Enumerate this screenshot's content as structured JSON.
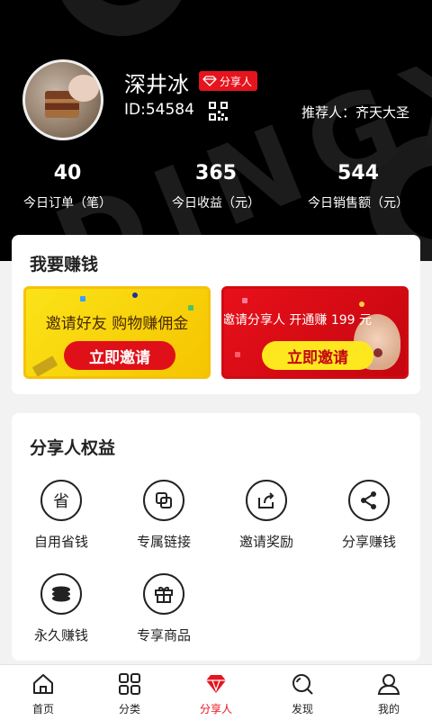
{
  "profile": {
    "name": "深井冰",
    "badge": "分享人",
    "id_text": "ID:54584",
    "referrer": "推荐人：齐天大圣"
  },
  "watermark": "DINGXIAO",
  "stats": [
    {
      "value": "40",
      "label": "今日订单（笔）"
    },
    {
      "value": "365",
      "label": "今日收益（元）"
    },
    {
      "value": "544",
      "label": "今日销售额（元）"
    }
  ],
  "earn": {
    "title": "我要赚钱",
    "banners": [
      {
        "text": "邀请好友  购物赚佣金",
        "button": "立即邀请"
      },
      {
        "text": "邀请分享人 开通赚 199 元",
        "button": "立即邀请"
      }
    ]
  },
  "benefits": {
    "title": "分享人权益",
    "items": [
      {
        "label": "自用省钱",
        "icon": "save-money-icon",
        "glyph": "省"
      },
      {
        "label": "专属链接",
        "icon": "link-icon"
      },
      {
        "label": "邀请奖励",
        "icon": "invite-reward-icon"
      },
      {
        "label": "分享赚钱",
        "icon": "share-icon"
      },
      {
        "label": "永久赚钱",
        "icon": "coins-icon"
      },
      {
        "label": "专享商品",
        "icon": "gift-icon"
      }
    ]
  },
  "tabs": [
    {
      "label": "首页",
      "icon": "home-icon"
    },
    {
      "label": "分类",
      "icon": "category-icon"
    },
    {
      "label": "分享人",
      "icon": "diamond-icon",
      "active": true
    },
    {
      "label": "发现",
      "icon": "discover-icon"
    },
    {
      "label": "我的",
      "icon": "profile-icon"
    }
  ],
  "colors": {
    "accent": "#e5141e",
    "header_bg": "#000000",
    "banner_yellow": "#fbe318"
  }
}
